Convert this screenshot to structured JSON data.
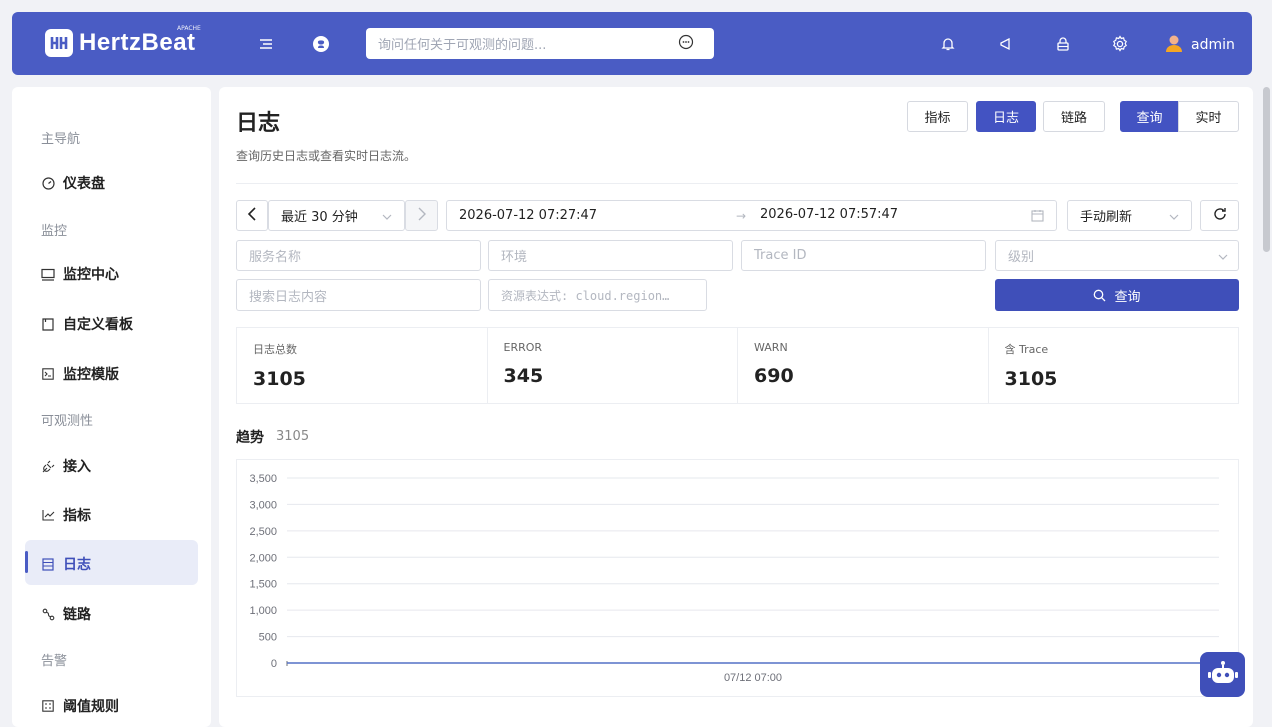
{
  "header": {
    "brand": "HertzBeat",
    "brand_sup": "APACHE",
    "search_placeholder": "询问任何关于可观测的问题...",
    "username": "admin"
  },
  "sidebar": {
    "groups": [
      "主导航",
      "监控",
      "可观测性",
      "告警"
    ],
    "items": [
      {
        "label": "仪表盘",
        "icon": "dashboard-icon"
      },
      {
        "label": "监控中心",
        "icon": "monitor-icon"
      },
      {
        "label": "自定义看板",
        "icon": "board-icon"
      },
      {
        "label": "监控模版",
        "icon": "template-icon"
      },
      {
        "label": "接入",
        "icon": "plug-icon"
      },
      {
        "label": "指标",
        "icon": "line-chart-icon"
      },
      {
        "label": "日志",
        "icon": "log-icon"
      },
      {
        "label": "链路",
        "icon": "trace-icon"
      },
      {
        "label": "阈值规则",
        "icon": "rule-icon"
      }
    ]
  },
  "page": {
    "title": "日志",
    "subtitle": "查询历史日志或查看实时日志流。",
    "tabs": [
      "指标",
      "日志",
      "链路"
    ],
    "modes": [
      "查询",
      "实时"
    ]
  },
  "filters": {
    "range": "最近 30 分钟",
    "start": "2026-07-12 07:27:47",
    "end": "2026-07-12 07:57:47",
    "refresh": "手动刷新",
    "service_placeholder": "服务名称",
    "env_placeholder": "环境",
    "trace_placeholder": "Trace ID",
    "level_placeholder": "级别",
    "content_placeholder": "搜索日志内容",
    "resource_placeholder": "资源表达式: cloud.region…",
    "query_label": "查询"
  },
  "stats": [
    {
      "label": "日志总数",
      "value": "3105"
    },
    {
      "label": "ERROR",
      "value": "345"
    },
    {
      "label": "WARN",
      "value": "690"
    },
    {
      "label": "含 Trace",
      "value": "3105"
    }
  ],
  "trend": {
    "title": "趋势",
    "count": "3105"
  },
  "chart_data": {
    "type": "line",
    "title": "",
    "xlabel": "",
    "ylabel": "",
    "ylim": [
      0,
      3500
    ],
    "y_ticks": [
      "3,500",
      "3,000",
      "2,500",
      "2,000",
      "1,500",
      "1,000",
      "500",
      "0"
    ],
    "y_tick_values": [
      3500,
      3000,
      2500,
      2000,
      1500,
      1000,
      500,
      0
    ],
    "x_tick_labels": [
      "07/12 07:00"
    ],
    "series": [
      {
        "values": [
          0,
          0
        ]
      }
    ],
    "grid": true,
    "colors": {
      "line": "#5470c6",
      "grid": "#e6e8ee"
    }
  }
}
